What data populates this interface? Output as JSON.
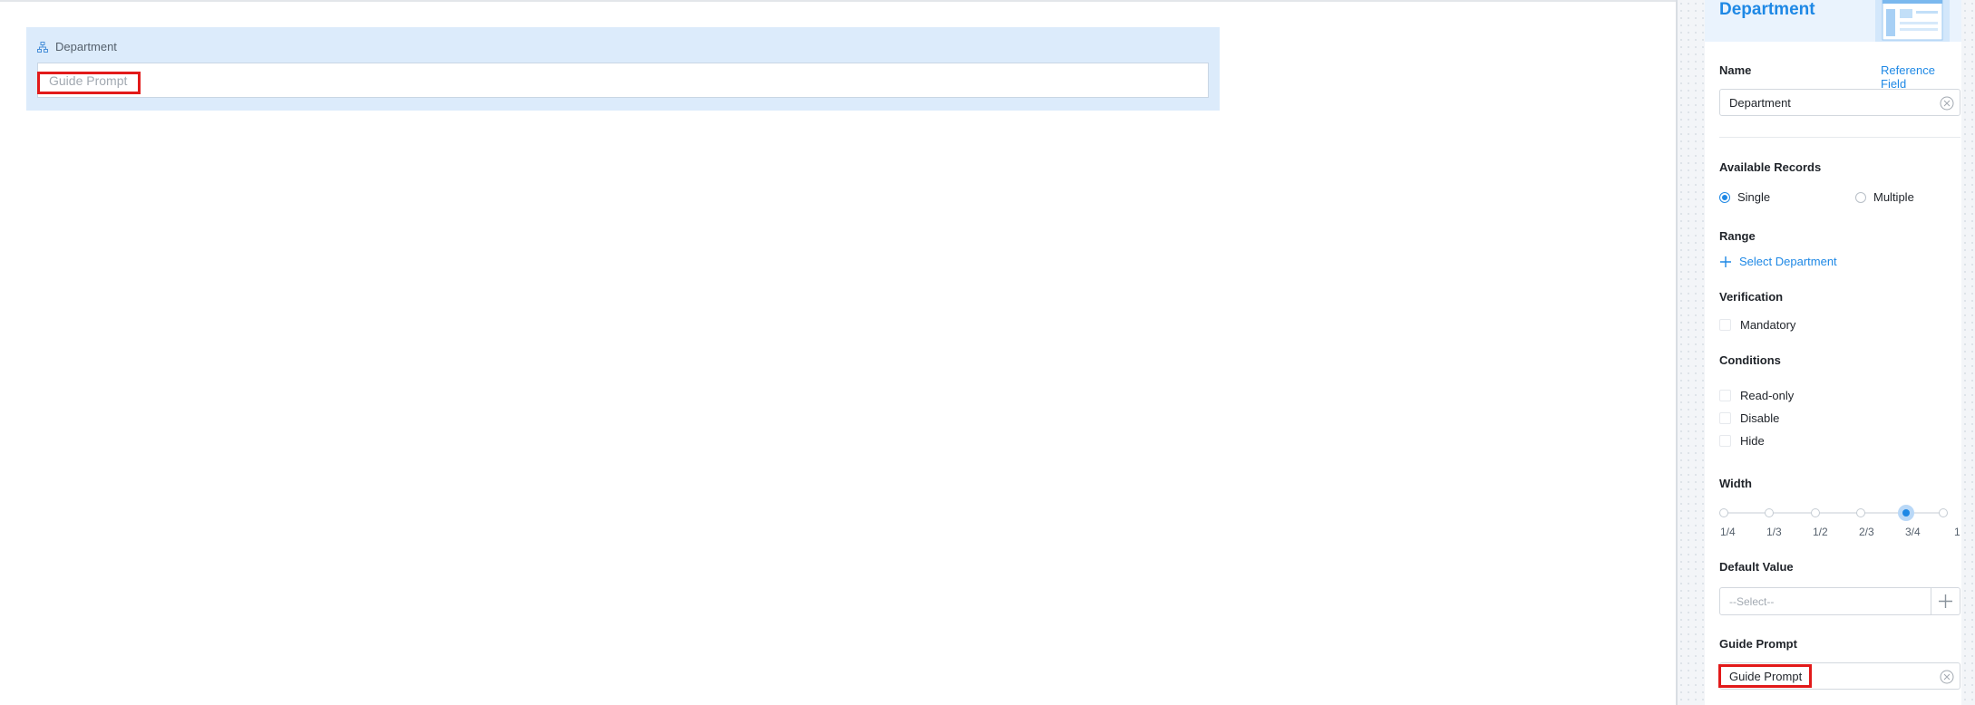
{
  "canvas": {
    "field_label": "Department",
    "field_placeholder": "Guide Prompt"
  },
  "panel": {
    "title": "Department",
    "name": {
      "label": "Name",
      "reference_link": "Reference Field",
      "value": "Department"
    },
    "available_records": {
      "label": "Available Records",
      "options": [
        {
          "label": "Single",
          "selected": true
        },
        {
          "label": "Multiple",
          "selected": false
        }
      ]
    },
    "range": {
      "label": "Range",
      "select_label": "Select Department"
    },
    "verification": {
      "label": "Verification",
      "mandatory": "Mandatory"
    },
    "conditions": {
      "label": "Conditions",
      "read_only": "Read-only",
      "disable": "Disable",
      "hide": "Hide"
    },
    "width": {
      "label": "Width",
      "ticks": [
        "1/4",
        "1/3",
        "1/2",
        "2/3",
        "3/4",
        "1"
      ],
      "selected": "3/4"
    },
    "default_value": {
      "label": "Default Value",
      "placeholder": "--Select--"
    },
    "guide_prompt": {
      "label": "Guide Prompt",
      "value": "Guide Prompt"
    }
  },
  "colors": {
    "accent": "#1e88e5",
    "highlight": "#e21a1a",
    "field_bg": "#dcebfb"
  },
  "icons": [
    "org-tree-icon",
    "clear-icon",
    "plus-icon"
  ]
}
